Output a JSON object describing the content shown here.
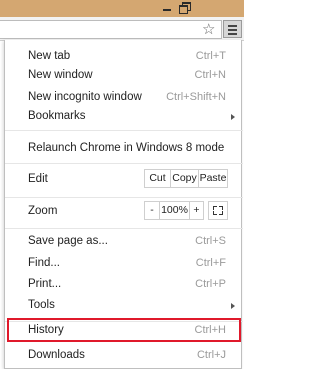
{
  "window": {
    "controls": [
      "minimize-icon",
      "restore-icon"
    ],
    "frame_color": "#d4a771"
  },
  "toolbar": {
    "bookmark_icon": "star-icon",
    "menu_icon": "hamburger-menu-icon"
  },
  "menu": {
    "items": [
      {
        "label": "New tab",
        "shortcut": "Ctrl+T"
      },
      {
        "label": "New window",
        "shortcut": "Ctrl+N"
      },
      {
        "label": "New incognito window",
        "shortcut": "Ctrl+Shift+N"
      },
      {
        "label": "Bookmarks",
        "shortcut": ""
      },
      {
        "label": "Relaunch Chrome in Windows 8 mode",
        "shortcut": ""
      },
      {
        "label": "Edit",
        "shortcut": ""
      },
      {
        "label": "Zoom",
        "shortcut": ""
      },
      {
        "label": "Save page as...",
        "shortcut": "Ctrl+S"
      },
      {
        "label": "Find...",
        "shortcut": "Ctrl+F"
      },
      {
        "label": "Print...",
        "shortcut": "Ctrl+P"
      },
      {
        "label": "Tools",
        "shortcut": ""
      },
      {
        "label": "History",
        "shortcut": "Ctrl+H"
      },
      {
        "label": "Downloads",
        "shortcut": "Ctrl+J"
      }
    ],
    "edit": {
      "cut": "Cut",
      "copy": "Copy",
      "paste": "Paste"
    },
    "zoom": {
      "minus": "-",
      "level": "100%",
      "plus": "+"
    },
    "highlight_color": "#e0192b"
  }
}
